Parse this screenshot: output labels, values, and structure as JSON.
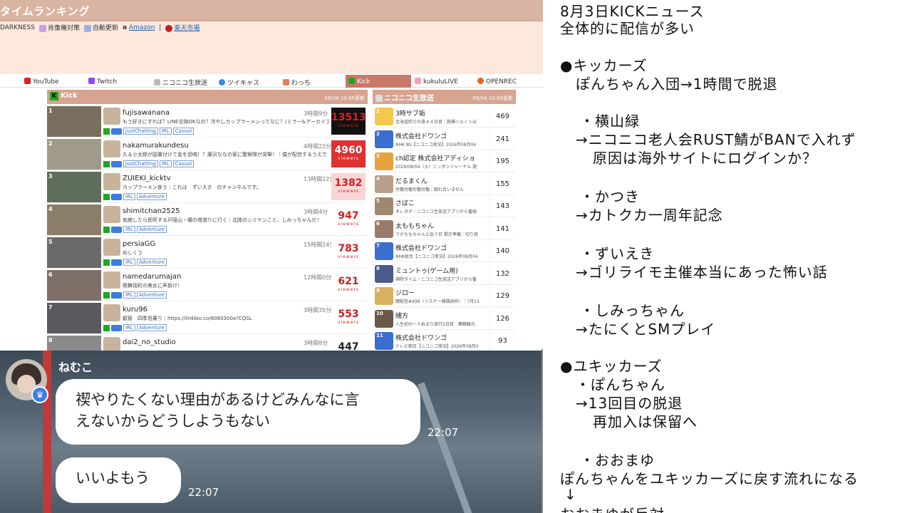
{
  "site": {
    "title": "タイムランキング",
    "options": [
      "DARKNESS",
      "肖像権対策",
      "自動更新"
    ],
    "links": [
      "Amazon",
      "楽天市場"
    ],
    "tabs": [
      "YouTube",
      "Twitch",
      "ニコニコ生放送",
      "ツイキャス",
      "わっち",
      "Kick",
      "kukuluLIVE",
      "OPENREC"
    ],
    "active_tab": "Kick"
  },
  "kick_panel": {
    "title": "Kick",
    "updated": "08/04 10:09更新",
    "rows": [
      {
        "rank": "1",
        "name": "fujisawanana",
        "duration": "3時間9分",
        "title": "もう好きにすれば？LINE交換OKなの？冷やしカップラーメンってなに？(ミラー&アーカイブ",
        "tags": [
          "JustChatting",
          "IRL",
          "Casual"
        ],
        "viewers": "13513",
        "viewers_label": "viewers",
        "box_color": "#111111",
        "num_color": "#e02020"
      },
      {
        "rank": "2",
        "name": "nakamurakundesu",
        "duration": "4時間22分",
        "title": "久＆小太郎が図書付けて金を恐喝！？藤沢ななの家に警察隊が突撃！｜僕が配信するうえで",
        "tags": [
          "JustChatting",
          "IRL",
          "Casual"
        ],
        "viewers": "4960",
        "viewers_label": "viewers",
        "box_color": "#e03030",
        "num_color": "#ffffff"
      },
      {
        "rank": "3",
        "name": "ZUIEKI_kicktv",
        "duration": "13時間22分",
        "title": "カップラーメン食う｜これは　ずいえき　のチャンネルです。",
        "tags": [
          "IRL",
          "Adventure"
        ],
        "viewers": "1382",
        "viewers_label": "viewers",
        "box_color": "#fbd5d5",
        "num_color": "#d02020"
      },
      {
        "rank": "4",
        "name": "shimitchan2525",
        "duration": "3時間4分",
        "title": "気絶したら即死する戸隠山・蟻の塔渡りに行く｜北陸のシミケンこと、しみっちゃんだ！",
        "tags": [
          "IRL",
          "Adventure"
        ],
        "viewers": "947",
        "viewers_label": "viewers",
        "box_color": "#ffffff",
        "num_color": "#d02020"
      },
      {
        "rank": "5",
        "name": "persiaGG",
        "duration": "15時間24分",
        "title": "めしくう",
        "tags": [
          "IRL",
          "Adventure"
        ],
        "viewers": "783",
        "viewers_label": "viewers",
        "box_color": "#ffffff",
        "num_color": "#d02020"
      },
      {
        "rank": "6",
        "name": "namedarumajan",
        "duration": "12時間0分",
        "title": "歌舞伎町の美女に声掛け！",
        "tags": [
          "IRL",
          "Adventure"
        ],
        "viewers": "621",
        "viewers_label": "viewers",
        "box_color": "#ffffff",
        "num_color": "#d02020"
      },
      {
        "rank": "7",
        "name": "kuru96",
        "duration": "3時間35分",
        "title": "叡智　四季島乗り｜https://linkbio.co/6080300a?CQSL",
        "tags": [
          "IRL",
          "Adventure"
        ],
        "viewers": "553",
        "viewers_label": "viewers",
        "box_color": "#ffffff",
        "num_color": "#d02020"
      },
      {
        "rank": "8",
        "name": "dai2_no_studio",
        "duration": "3時間8分",
        "title": "",
        "tags": [],
        "viewers": "447",
        "viewers_label": "viewers",
        "box_color": "#ffffff",
        "num_color": "#222222"
      }
    ]
  },
  "nico_panel": {
    "title": "ニコニコ生放送",
    "updated": "08/04 10:09更新",
    "rows": [
      {
        "rank": "1",
        "name": "3時サブ垢",
        "sub": "北海道釣りの旅４４日目｜脱褌＜ｂｒ＞ほ",
        "count": "469",
        "color": "#f2c94c"
      },
      {
        "rank": "2",
        "name": "株式会社ドワンゴ",
        "sub": "NHK BS【ニコニコ実況】2026年08月04",
        "count": "241",
        "color": "#3a6fd0"
      },
      {
        "rank": "3",
        "name": "ch認定 株式会社アディショ",
        "sub": "2026/08/04（火）ニッポンジャーナル 脱",
        "count": "195",
        "color": "#e6a23c"
      },
      {
        "rank": "4",
        "name": "だるまくん",
        "sub": "労働労働労働労働｜朝れ合いません",
        "count": "155",
        "color": "#b8a08a"
      },
      {
        "rank": "5",
        "name": "さぼこ",
        "sub": "オレタチ｜ニコニコ生放送アプリから番組",
        "count": "143",
        "color": "#a08870"
      },
      {
        "rank": "6",
        "name": "太ももちゃん",
        "sub": "でかももちゃんと会う日 掲示準備｜切り目",
        "count": "141",
        "color": "#9a7a6a"
      },
      {
        "rank": "7",
        "name": "株式会社ドワンゴ",
        "sub": "NHK総合【ニコニコ実況】2026年08月04",
        "count": "140",
        "color": "#3a6fd0"
      },
      {
        "rank": "8",
        "name": "ミュントゥ(ゲーム用)",
        "sub": "掃除タイム｜ニコニコ生放送アプリから番",
        "count": "132",
        "color": "#4a5a8a"
      },
      {
        "rank": "9",
        "name": "ジロー",
        "sub": "聴配信#499（リスナー様随読枠）｜7月13",
        "count": "129",
        "color": "#d8b060"
      },
      {
        "rank": "10",
        "name": "緒方",
        "sub": "人生初の一人ぬまり旅行2日目　舞鶴観光",
        "count": "126",
        "color": "#6a5a4a"
      },
      {
        "rank": "11",
        "name": "株式会社ドワンゴ",
        "sub": "テレビ朝日【ニコニコ実況】2026年08月0",
        "count": "93",
        "color": "#3a6fd0"
      }
    ]
  },
  "chat": {
    "username": "ねむこ",
    "messages": [
      {
        "text1": "禊やりたくない理由があるけどみんなに言",
        "text2": "えないからどうしようもない",
        "time": "22:07"
      },
      {
        "text1": "いいよもう",
        "text2": "",
        "time": "22:07"
      }
    ]
  },
  "notes": {
    "lines": [
      "8月3日KICKニュース",
      "全体的に配信が多い",
      "●キッカーズ",
      "ぽんちゃん入団→1時間で脱退",
      "・横山緑",
      "→ニコニコ老人会RUST鯖がBANで入れず",
      "原因は海外サイトにログインか？",
      "・かつき",
      "→カトクカ一周年記念",
      "・ずいえき",
      "→ゴリライモ主催本当にあった怖い話",
      "・しみっちゃん",
      "→たにくとSMプレイ",
      "●ユキッカーズ",
      "・ぽんちゃん",
      "→13回目の脱退",
      "再加入は保留へ",
      "・おおまゆ",
      "ぽんちゃんをユキッカーズに戻す流れになる",
      "↓",
      "おおまゆが反対"
    ]
  }
}
